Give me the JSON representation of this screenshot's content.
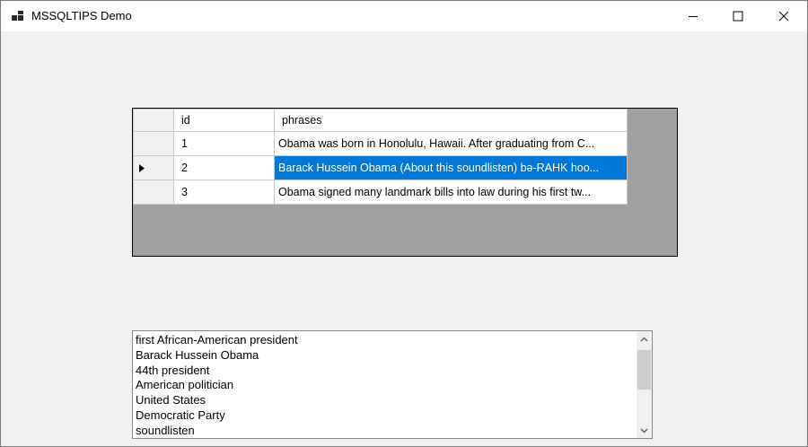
{
  "window": {
    "title": "MSSQLTIPS Demo",
    "icons": {
      "app": "app-grid-icon",
      "minimize": "minimize-icon",
      "maximize": "maximize-icon",
      "close": "close-icon"
    }
  },
  "grid": {
    "columns": [
      "id",
      "phrases"
    ],
    "rows": [
      {
        "id": "1",
        "phrase": "Obama was born in Honolulu, Hawaii. After graduating from C..."
      },
      {
        "id": "2",
        "phrase": "Barack Hussein Obama  (About this soundlisten) bə-RAHK hoo...",
        "selected": true
      },
      {
        "id": "3",
        "phrase": "Obama signed many landmark bills into law during his first tw..."
      }
    ],
    "current_row_indicator": "row-pointer-icon",
    "colors": {
      "selection": "#0078d7",
      "background": "#a0a0a0"
    }
  },
  "listbox": {
    "items": [
      "first African-American president",
      "Barack Hussein Obama",
      "44th president",
      "American politician",
      "United States",
      "Democratic Party",
      "soundlisten"
    ],
    "scroll_icons": {
      "up": "scroll-up-icon",
      "down": "scroll-down-icon"
    }
  }
}
